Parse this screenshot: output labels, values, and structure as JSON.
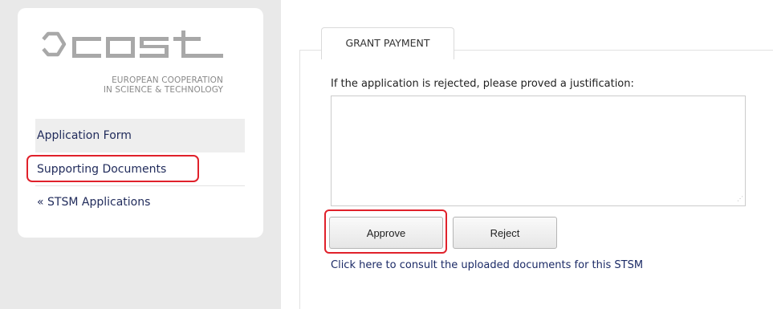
{
  "logo": {
    "name": "cost",
    "tagline_line1": "EUROPEAN COOPERATION",
    "tagline_line2": "IN SCIENCE & TECHNOLOGY",
    "color": "#a8a8a8"
  },
  "sidebar": {
    "items": [
      {
        "label": "Application Form"
      },
      {
        "label": "Supporting Documents",
        "highlighted": true
      },
      {
        "label": "« STSM Applications"
      }
    ]
  },
  "tabs": [
    {
      "label": "GRANT PAYMENT",
      "active": true
    }
  ],
  "form": {
    "justification_label": "If the application is rejected, please proved a justification:",
    "justification_value": "",
    "approve_label": "Approve",
    "reject_label": "Reject",
    "consult_link": "Click here to consult the uploaded documents for this STSM"
  },
  "colors": {
    "highlight": "#e0212b",
    "nav_text": "#1f2a5a",
    "sidebar_bg": "#e9e9e9"
  }
}
